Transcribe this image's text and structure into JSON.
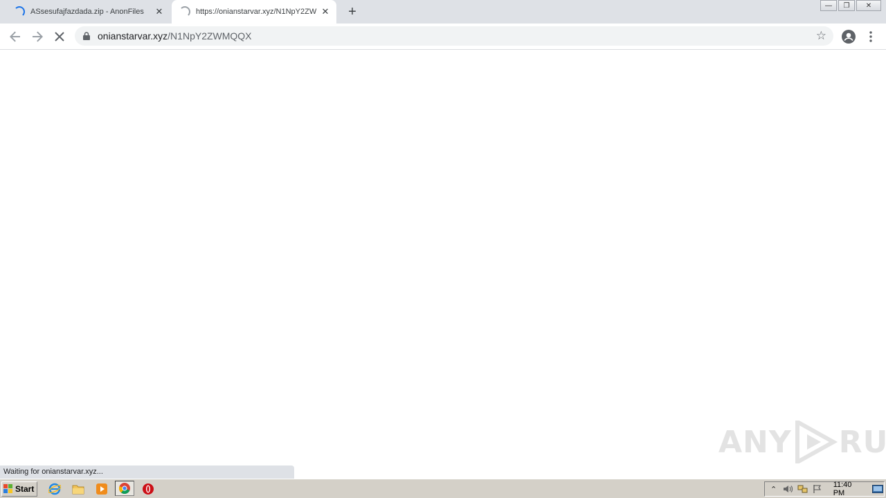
{
  "tabs": [
    {
      "title": "ASsesufajfazdada.zip - AnonFiles",
      "close": "✕"
    },
    {
      "title": "https://onianstarvar.xyz/N1NpY2ZW",
      "close": "✕"
    }
  ],
  "new_tab": "+",
  "window_controls": {
    "minimize": "—",
    "restore": "❐",
    "close": "✕"
  },
  "address": {
    "host": "onianstarvar.xyz",
    "path": "/N1NpY2ZWMQQX"
  },
  "status_text": "Waiting for onianstarvar.xyz...",
  "watermark": {
    "left": "ANY",
    "right": "RUN"
  },
  "taskbar": {
    "start_label": "Start",
    "clock": "11:40 PM"
  },
  "colors": {
    "tabstrip": "#dee1e6",
    "omnibox": "#f1f3f4",
    "spinner": "#1a73e8",
    "taskbar": "#d4d0c8"
  }
}
